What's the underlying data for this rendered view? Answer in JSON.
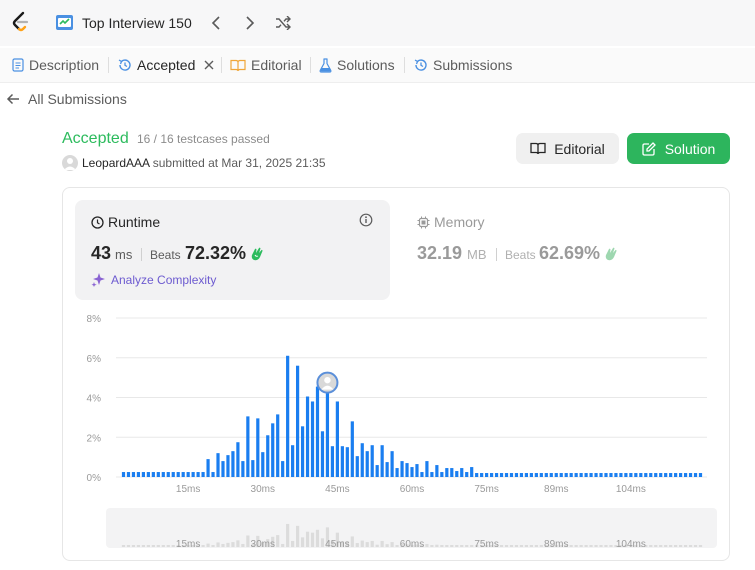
{
  "topbar": {
    "list_title": "Top Interview 150"
  },
  "tabs": [
    {
      "label": "Description"
    },
    {
      "label": "Accepted"
    },
    {
      "label": "Editorial"
    },
    {
      "label": "Solutions"
    },
    {
      "label": "Submissions"
    }
  ],
  "back_link": "All Submissions",
  "submission": {
    "status": "Accepted",
    "testcases": "16 / 16 testcases passed",
    "username": "LeopardAAA",
    "submitted_text": "submitted at Mar 31, 2025 21:35"
  },
  "buttons": {
    "editorial": "Editorial",
    "solution": "Solution"
  },
  "runtime": {
    "label": "Runtime",
    "value": "43",
    "unit": "ms",
    "beats_label": "Beats",
    "beats": "72.32%",
    "analyze": "Analyze Complexity"
  },
  "memory": {
    "label": "Memory",
    "value": "32.19",
    "unit": "MB",
    "beats_label": "Beats",
    "beats": "62.69%"
  },
  "colors": {
    "accepted": "#2cbb5d",
    "bar": "#1a7ef0",
    "bar_overview": "#dcdcdc",
    "analyze": "#6d5bd0"
  },
  "chart_data": {
    "type": "bar",
    "x_unit": "ms",
    "ylim": [
      0,
      8
    ],
    "y_ticks": [
      "8%",
      "6%",
      "4%",
      "2%",
      "0%"
    ],
    "x_ticks": [
      "15ms",
      "30ms",
      "45ms",
      "60ms",
      "75ms",
      "89ms",
      "104ms"
    ],
    "x_tick_values": [
      15,
      30,
      45,
      60,
      75,
      89,
      104
    ],
    "x_range": [
      2,
      118
    ],
    "bin_width": 1,
    "highlight_x": 43,
    "grid": true,
    "values": [
      0.25,
      0.25,
      0.25,
      0.25,
      0.25,
      0.25,
      0.25,
      0.25,
      0.25,
      0.25,
      0.25,
      0.25,
      0.25,
      0.25,
      0.25,
      0.25,
      0.25,
      0.9,
      0.25,
      1.2,
      0.8,
      1.1,
      1.3,
      1.75,
      0.8,
      3.05,
      0.85,
      2.95,
      1.25,
      2.1,
      2.7,
      3.15,
      0.8,
      6.1,
      1.6,
      5.6,
      2.55,
      4.05,
      3.8,
      4.55,
      2.3,
      5.2,
      1.55,
      3.8,
      1.55,
      1.5,
      2.8,
      1.05,
      1.7,
      1.3,
      1.6,
      0.6,
      1.6,
      0.75,
      1.3,
      0.45,
      0.8,
      0.7,
      0.5,
      0.65,
      0.25,
      0.8,
      0.25,
      0.6,
      0.25,
      0.45,
      0.45,
      0.3,
      0.45,
      0.25,
      0.5,
      0.2,
      0.2,
      0.2,
      0.2,
      0.2,
      0.2,
      0.2,
      0.2,
      0.2,
      0.2,
      0.2,
      0.2,
      0.2,
      0.2,
      0.2,
      0.2,
      0.2,
      0.2,
      0.2,
      0.2,
      0.2,
      0.2,
      0.2,
      0.2,
      0.2,
      0.2,
      0.2,
      0.2,
      0.2,
      0.2,
      0.2,
      0.2,
      0.2,
      0.2,
      0.2,
      0.2,
      0.2,
      0.2,
      0.2,
      0.2,
      0.2,
      0.2,
      0.2,
      0.2,
      0.2,
      0.2
    ]
  }
}
